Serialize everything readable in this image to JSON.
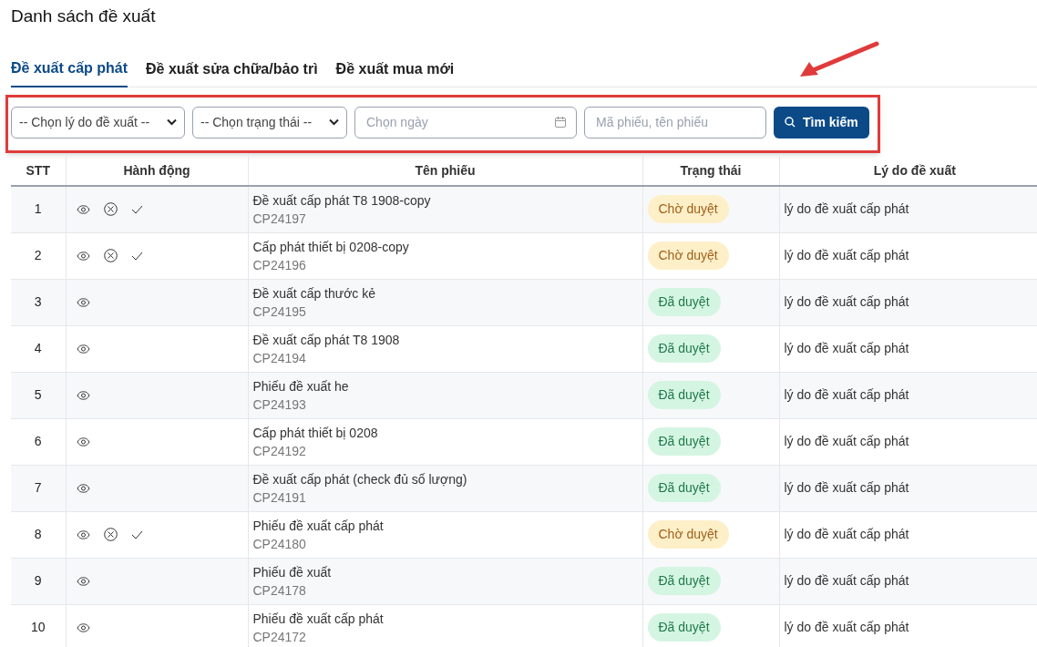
{
  "page_title": "Danh sách đề xuất",
  "tabs": [
    {
      "label": "Đề xuất cấp phát",
      "selected": true
    },
    {
      "label": "Đề xuất sửa chữa/bảo trì",
      "selected": false
    },
    {
      "label": "Đề xuất mua mới",
      "selected": false
    }
  ],
  "filters": {
    "reason_select": "-- Chọn lý do đề xuất --",
    "status_select": "-- Chọn trạng thái --",
    "date_field": {
      "placeholder": "Chọn ngày"
    },
    "search_field": {
      "placeholder": "Mã phiếu, tên phiếu"
    },
    "search_button": "Tìm kiếm"
  },
  "table": {
    "columns": [
      "STT",
      "Hành động",
      "Tên phiếu",
      "Trạng thái",
      "Lý do đề xuất"
    ],
    "rows": [
      {
        "stt": "1",
        "actions": [
          {
            "kind": "view"
          },
          {
            "kind": "reject"
          },
          {
            "kind": "approve"
          }
        ],
        "name": "Đề xuất cấp phát T8 1908-copy",
        "code": "CP24197",
        "status": {
          "kind": "pending",
          "label": "Chờ duyệt"
        },
        "reason": "lý do đề xuất cấp phát"
      },
      {
        "stt": "2",
        "actions": [
          {
            "kind": "view"
          },
          {
            "kind": "reject"
          },
          {
            "kind": "approve"
          }
        ],
        "name": "Cấp phát thiết bị 0208-copy",
        "code": "CP24196",
        "status": {
          "kind": "pending",
          "label": "Chờ duyệt"
        },
        "reason": "lý do đề xuất cấp phát"
      },
      {
        "stt": "3",
        "actions": [
          {
            "kind": "view"
          }
        ],
        "name": "Đề xuất cấp thước kẻ",
        "code": "CP24195",
        "status": {
          "kind": "approved",
          "label": "Đã duyệt"
        },
        "reason": "lý do đề xuất cấp phát"
      },
      {
        "stt": "4",
        "actions": [
          {
            "kind": "view"
          }
        ],
        "name": "Đề xuất cấp phát T8 1908",
        "code": "CP24194",
        "status": {
          "kind": "approved",
          "label": "Đã duyệt"
        },
        "reason": "lý do đề xuất cấp phát"
      },
      {
        "stt": "5",
        "actions": [
          {
            "kind": "view"
          }
        ],
        "name": "Phiếu đề xuất he",
        "code": "CP24193",
        "status": {
          "kind": "approved",
          "label": "Đã duyệt"
        },
        "reason": "lý do đề xuất cấp phát"
      },
      {
        "stt": "6",
        "actions": [
          {
            "kind": "view"
          }
        ],
        "name": "Cấp phát thiết bị 0208",
        "code": "CP24192",
        "status": {
          "kind": "approved",
          "label": "Đã duyệt"
        },
        "reason": "lý do đề xuất cấp phát"
      },
      {
        "stt": "7",
        "actions": [
          {
            "kind": "view"
          }
        ],
        "name": "Đề xuất cấp phát (check đủ số lượng)",
        "code": "CP24191",
        "status": {
          "kind": "approved",
          "label": "Đã duyệt"
        },
        "reason": "lý do đề xuất cấp phát"
      },
      {
        "stt": "8",
        "actions": [
          {
            "kind": "view"
          },
          {
            "kind": "reject"
          },
          {
            "kind": "approve"
          }
        ],
        "name": "Phiếu đề xuất cấp phát",
        "code": "CP24180",
        "status": {
          "kind": "pending",
          "label": "Chờ duyệt"
        },
        "reason": "lý do đề xuất cấp phát"
      },
      {
        "stt": "9",
        "actions": [
          {
            "kind": "view"
          }
        ],
        "name": "Phiếu đề xuất",
        "code": "CP24178",
        "status": {
          "kind": "approved",
          "label": "Đã duyệt"
        },
        "reason": "lý do đề xuất cấp phát"
      },
      {
        "stt": "10",
        "actions": [
          {
            "kind": "view"
          }
        ],
        "name": "Phiếu đề xuất cấp phát",
        "code": "CP24172",
        "status": {
          "kind": "approved",
          "label": "Đã duyệt"
        },
        "reason": "lý do đề xuất cấp phát"
      }
    ]
  }
}
